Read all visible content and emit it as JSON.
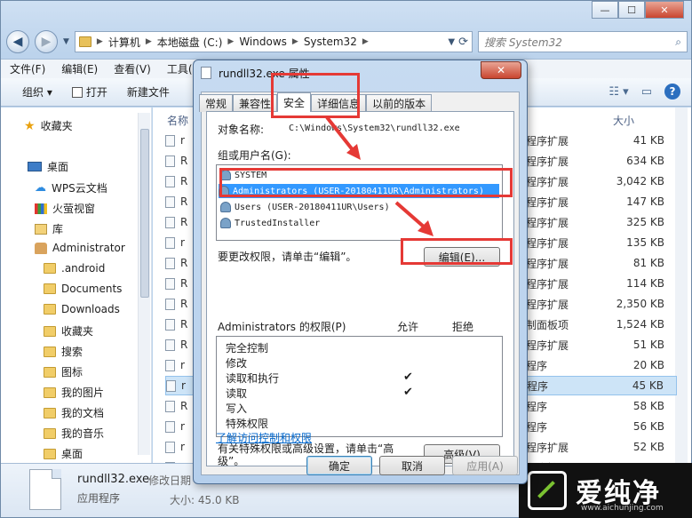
{
  "explorer": {
    "address": {
      "crumbs": [
        "计算机",
        "本地磁盘 (C:)",
        "Windows",
        "System32"
      ]
    },
    "search_placeholder": "搜索 System32",
    "menu": [
      "文件(F)",
      "编辑(E)",
      "查看(V)",
      "工具("
    ],
    "toolbar": {
      "organize": "组织 ▾",
      "open": "打开",
      "new_folder": "新建文件"
    },
    "nav": [
      {
        "label": "收藏夹",
        "icon": "star-icon"
      },
      {
        "label": "桌面",
        "icon": "desktop-icon"
      },
      {
        "label": "WPS云文档",
        "icon": "cloud-icon"
      },
      {
        "label": "火萤视窗",
        "icon": "video-icon"
      },
      {
        "label": "库",
        "icon": "library-icon"
      },
      {
        "label": "Administrator",
        "icon": "user-icon"
      },
      {
        "label": ".android",
        "icon": "folder-icon"
      },
      {
        "label": "Documents",
        "icon": "folder-icon"
      },
      {
        "label": "Downloads",
        "icon": "folder-icon"
      },
      {
        "label": "收藏夹",
        "icon": "folder-icon"
      },
      {
        "label": "搜索",
        "icon": "folder-icon"
      },
      {
        "label": "图标",
        "icon": "folder-icon"
      },
      {
        "label": "我的图片",
        "icon": "folder-icon"
      },
      {
        "label": "我的文档",
        "icon": "folder-icon"
      },
      {
        "label": "我的音乐",
        "icon": "folder-icon"
      },
      {
        "label": "桌面",
        "icon": "folder-icon"
      }
    ],
    "columns": {
      "name": "名称",
      "size": "大小"
    },
    "files": [
      {
        "n": "r",
        "t": "程序扩展",
        "s": "41 KB"
      },
      {
        "n": "R",
        "t": "程序扩展",
        "s": "634 KB"
      },
      {
        "n": "R",
        "t": "程序扩展",
        "s": "3,042 KB"
      },
      {
        "n": "R",
        "t": "程序扩展",
        "s": "147 KB"
      },
      {
        "n": "R",
        "t": "程序扩展",
        "s": "325 KB"
      },
      {
        "n": "r",
        "t": "程序扩展",
        "s": "135 KB"
      },
      {
        "n": "R",
        "t": "程序扩展",
        "s": "81 KB"
      },
      {
        "n": "R",
        "t": "程序扩展",
        "s": "114 KB"
      },
      {
        "n": "R",
        "t": "程序扩展",
        "s": "2,350 KB"
      },
      {
        "n": "R",
        "t": "制面板项",
        "s": "1,524 KB"
      },
      {
        "n": "R",
        "t": "程序扩展",
        "s": "51 KB"
      },
      {
        "n": "r",
        "t": "程序",
        "s": "20 KB"
      },
      {
        "n": "r",
        "t": "程序",
        "s": "45 KB",
        "selected": true
      },
      {
        "n": "R",
        "t": "程序",
        "s": "58 KB"
      },
      {
        "n": "r",
        "t": "程序",
        "s": "56 KB"
      },
      {
        "n": "r",
        "t": "程序扩展",
        "s": "52 KB"
      },
      {
        "n": "s",
        "t": "程序扩展",
        "s": "66 KB"
      }
    ],
    "details": {
      "name": "rundll32.exe",
      "modified_label": "修改日期",
      "type": "应用程序",
      "size": "大小: 45.0 KB"
    }
  },
  "dialog": {
    "title": "rundll32.exe 属性",
    "close_label": "✕",
    "tabs": [
      "常规",
      "兼容性",
      "安全",
      "详细信息",
      "以前的版本"
    ],
    "active_tab": "安全",
    "object_name_label": "对象名称:",
    "object_name_value": "C:\\Windows\\System32\\rundll32.exe",
    "group_label": "组或用户名(G):",
    "users": [
      {
        "name": "SYSTEM"
      },
      {
        "name": "Administrators (USER-20180411UR\\Administrators)",
        "selected": true
      },
      {
        "name": "Users (USER-20180411UR\\Users)"
      },
      {
        "name": "TrustedInstaller"
      }
    ],
    "change_perm_text": "要更改权限，请单击“编辑”。",
    "edit_button": "编辑(E)...",
    "perm_title": "Administrators 的权限(P)",
    "allow_label": "允许",
    "deny_label": "拒绝",
    "permissions": [
      {
        "name": "完全控制",
        "allow": false
      },
      {
        "name": "修改",
        "allow": false
      },
      {
        "name": "读取和执行",
        "allow": true
      },
      {
        "name": "读取",
        "allow": true
      },
      {
        "name": "写入",
        "allow": false
      },
      {
        "name": "特殊权限",
        "allow": false
      }
    ],
    "advanced_text": "有关特殊权限或高级设置，请单击“高级”。",
    "advanced_button": "高级(V)",
    "learn_link": "了解访问控制和权限",
    "ok_button": "确定",
    "cancel_button": "取消",
    "apply_button": "应用(A)"
  },
  "watermark": {
    "text": "爱纯净",
    "url": "www.aichunjing.com"
  },
  "colors": {
    "highlight": "#e53935",
    "selection": "#3399ff",
    "link": "#0066cc"
  }
}
